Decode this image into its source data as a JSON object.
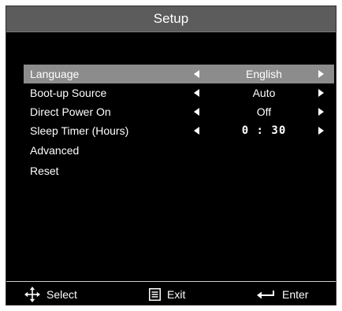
{
  "window": {
    "title": "Setup"
  },
  "menu": {
    "items": [
      {
        "label": "Language",
        "value": "English",
        "selected": true
      },
      {
        "label": "Boot-up Source",
        "value": "Auto",
        "selected": false
      },
      {
        "label": "Direct Power On",
        "value": "Off",
        "selected": false
      },
      {
        "label": "Sleep Timer (Hours)",
        "value": "0 : 30",
        "selected": false
      },
      {
        "label": "Advanced"
      },
      {
        "label": "Reset"
      }
    ]
  },
  "footer": {
    "select_label": "Select",
    "exit_label": "Exit",
    "enter_label": "Enter",
    "select_icon": "four-way-arrows-icon",
    "exit_icon": "menu-icon",
    "enter_icon": "enter-arrow-icon"
  },
  "colors": {
    "background": "#000000",
    "title_bar": "#5c5c5c",
    "selected_row": "#8c8c8c",
    "text": "#ffffff"
  }
}
